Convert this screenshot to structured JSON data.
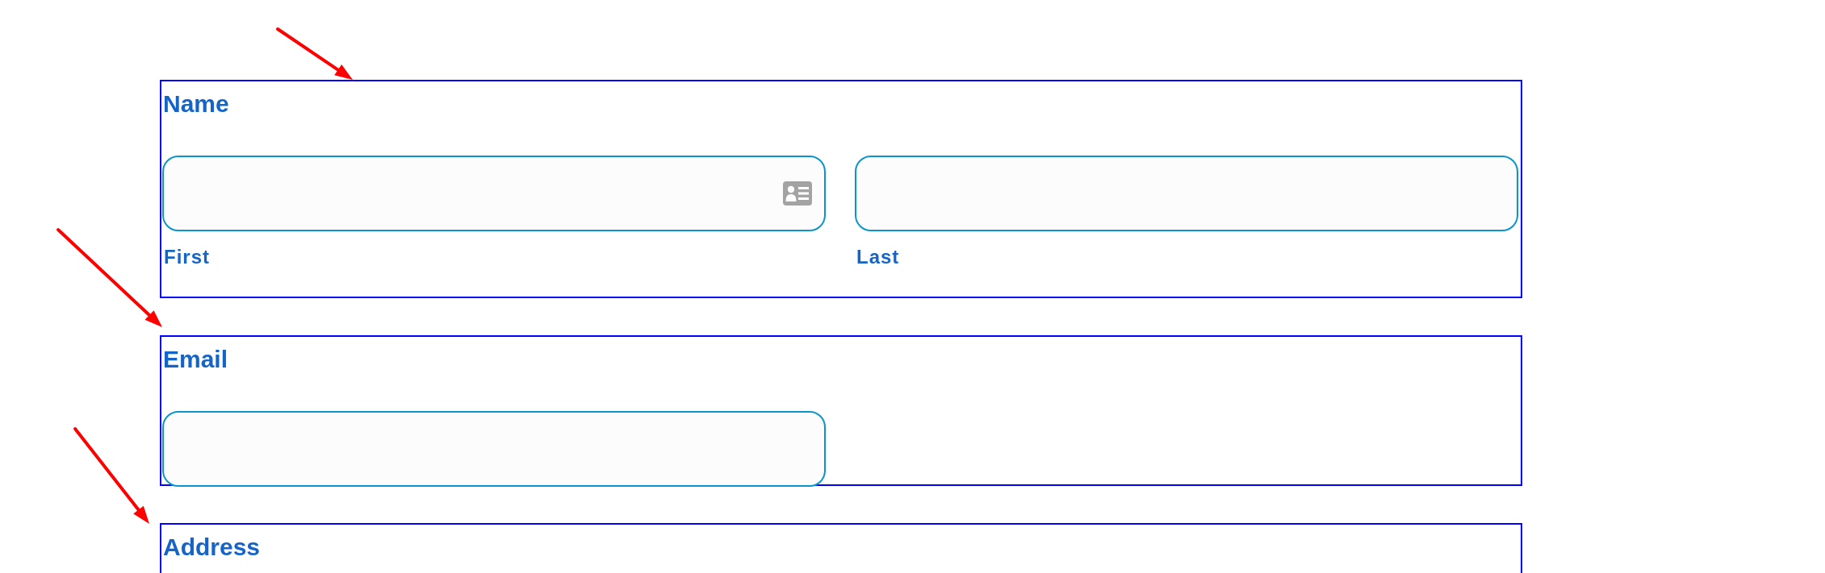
{
  "sections": [
    {
      "label": "Name",
      "fields": [
        {
          "autofill": true,
          "sublabel": "First"
        },
        {
          "autofill": false,
          "sublabel": "Last"
        }
      ]
    },
    {
      "label": "Email",
      "fields": [
        {
          "autofill": false
        }
      ]
    },
    {
      "label": "Address"
    }
  ]
}
